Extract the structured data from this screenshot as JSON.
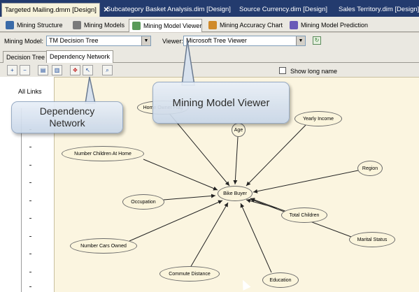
{
  "document_tabs": [
    {
      "label": "Targeted Mailing.dmm [Design]",
      "active": true
    },
    {
      "label": "Subcategory Basket Analysis.dim [Design]",
      "active": false
    },
    {
      "label": "Source Currency.dim [Design]",
      "active": false
    },
    {
      "label": "Sales Territory.dim [Design]",
      "active": false
    }
  ],
  "close_glyph": "✕",
  "designer_tabs": [
    {
      "label": "Mining Structure",
      "icon": "mining-structure-icon"
    },
    {
      "label": "Mining Models",
      "icon": "mining-models-icon"
    },
    {
      "label": "Mining Model Viewer",
      "icon": "mining-model-viewer-icon",
      "active": true
    },
    {
      "label": "Mining Accuracy Chart",
      "icon": "accuracy-chart-icon"
    },
    {
      "label": "Mining Model Prediction",
      "icon": "prediction-icon"
    }
  ],
  "model_row": {
    "mining_model_label": "Mining Model:",
    "mining_model_value": "TM Decision Tree",
    "viewer_label": "Viewer:",
    "viewer_value": "Microsoft Tree Viewer"
  },
  "viewer_tabs": [
    {
      "label": "Decision Tree",
      "active": false
    },
    {
      "label": "Dependency Network",
      "active": true
    }
  ],
  "toolbar": {
    "buttons": [
      "zoom-in-icon",
      "zoom-out-icon",
      "copy-icon",
      "copy-graph-icon",
      "fit-to-window-icon",
      "select-node-icon",
      "find-node-icon"
    ],
    "show_long_name_label": "Show long name",
    "show_long_name_checked": false
  },
  "slider": {
    "label": "All Links"
  },
  "network": {
    "center": "Bike Buyer",
    "nodes": [
      "Home Owner Flag",
      "Age",
      "Yearly Income",
      "Number Children At Home",
      "Region",
      "Occupation",
      "Total Children",
      "Marital Status",
      "Number Cars Owned",
      "Commute Distance",
      "Education"
    ]
  },
  "callouts": {
    "viewer": "Mining Model Viewer",
    "dependency_line1": "Dependency",
    "dependency_line2": "Network"
  },
  "colors": {
    "doc_tab_bar": "#233b6e",
    "canvas": "#fbf5e0",
    "node_fill": "#fbf5dc"
  }
}
